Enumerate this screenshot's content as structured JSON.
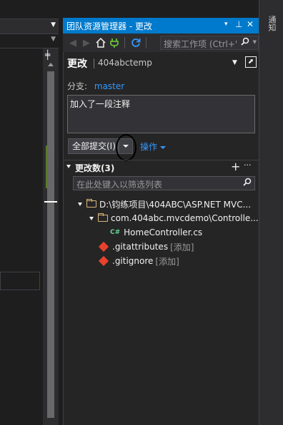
{
  "panel": {
    "title": "团队资源管理器 - 更改",
    "pin_glyph": "▾",
    "autohide_glyph": "⊥",
    "close_glyph": "✕"
  },
  "toolbar": {
    "search_placeholder": "搜索工作项 (Ctrl+'"
  },
  "header": {
    "title": "更改",
    "repo": "404abctemp"
  },
  "branch": {
    "label": "分支:",
    "name": "master"
  },
  "commit": {
    "message": "加入了一段注释",
    "commit_all_label": "全部提交(I)",
    "actions_label": "操作"
  },
  "changes": {
    "section_title": "更改数(3)",
    "filter_placeholder": "在此处键入以筛选列表",
    "tree": [
      {
        "kind": "folder",
        "label": "D:\\钧练项目\\404ABC\\ASP.NET MVC..."
      },
      {
        "kind": "folder",
        "label": "com.404abc.mvcdemo\\Controlle..."
      },
      {
        "kind": "cs",
        "badge": "C#",
        "label": "HomeController.cs"
      },
      {
        "kind": "git",
        "label": ".gitattributes",
        "tag": "[添加]"
      },
      {
        "kind": "git",
        "label": ".gitignore",
        "tag": "[添加]"
      }
    ]
  },
  "right_strip": {
    "label": "通知"
  },
  "colors": {
    "titlebar": "#007acc",
    "link": "#3399ff",
    "panel_bg": "#252526"
  }
}
